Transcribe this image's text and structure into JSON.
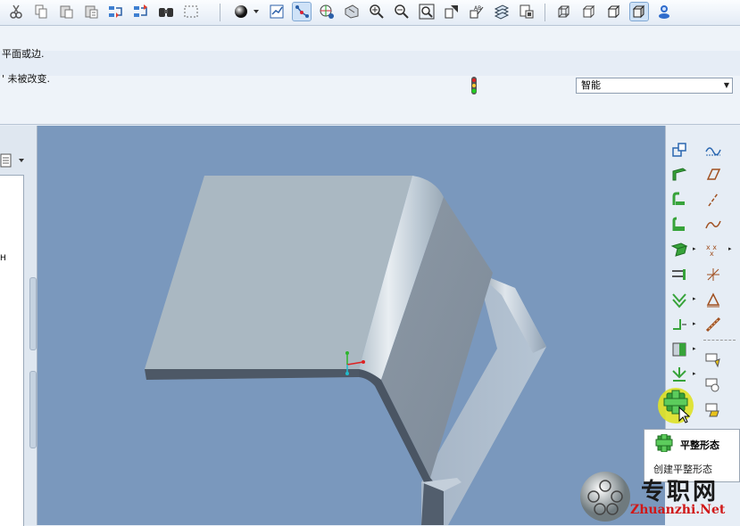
{
  "toolbar": {
    "icons": [
      "cut-icon",
      "copy-icon",
      "paste-icon",
      "paste-special-icon",
      "regenerate-icon",
      "regenerate-manager-icon",
      "find-icon",
      "select-box-icon",
      "appearance-icon",
      "display-style-icon",
      "datum-display-icon",
      "spin-center-icon",
      "zoom-in-icon",
      "zoom-out-icon",
      "refit-icon",
      "reorient-icon",
      "annotation-icon",
      "layers-icon",
      "model-tree-icon",
      "wireframe-icon",
      "hidden-line-icon",
      "no-hidden-icon",
      "shading-icon",
      "help-icon"
    ]
  },
  "messages": {
    "line1": "平面或边.",
    "line2": "' 未被改变."
  },
  "filter": {
    "selected": "智能"
  },
  "tooltip": {
    "title": "平整形态",
    "description": "创建平整形态"
  },
  "watermark": {
    "text": "专职网",
    "url": "Zhuanzhi.Net"
  },
  "colors": {
    "viewport_bg": "#7a98bd",
    "model_top": "#aab8c2",
    "highlight": "#dee228",
    "watermark_url": "#d01818"
  }
}
